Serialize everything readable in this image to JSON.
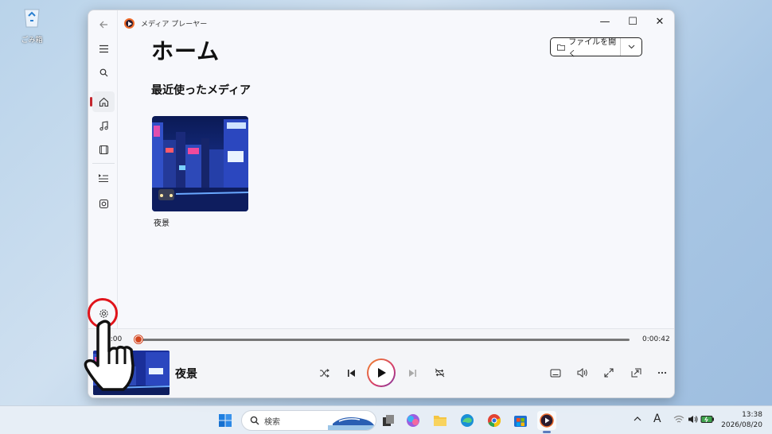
{
  "desktop": {
    "recycle_bin_label": "ごみ箱"
  },
  "window": {
    "app_title": "メディア プレーヤー",
    "controls": {
      "minimize": "—",
      "maximize": "☐",
      "close": "✕"
    }
  },
  "sidebar": {
    "items": [
      {
        "name": "back",
        "icon": "back-arrow-icon"
      },
      {
        "name": "menu",
        "icon": "hamburger-icon"
      },
      {
        "name": "search",
        "icon": "search-icon"
      },
      {
        "name": "home",
        "icon": "home-icon",
        "active": true
      },
      {
        "name": "music",
        "icon": "music-note-icon"
      },
      {
        "name": "video",
        "icon": "film-icon"
      },
      {
        "name": "play-queue",
        "icon": "queue-icon"
      },
      {
        "name": "playlists",
        "icon": "playlist-icon"
      },
      {
        "name": "settings",
        "icon": "gear-icon"
      }
    ]
  },
  "main": {
    "page_title": "ホーム",
    "open_file_label": "ファイルを開く",
    "section_title": "最近使ったメディア",
    "recent_media": [
      {
        "title": "夜景"
      }
    ]
  },
  "player": {
    "time_elapsed": "0:00",
    "time_total": "0:00:42",
    "progress_fraction": 0.0,
    "now_playing_title": "夜景"
  },
  "taskbar": {
    "search_placeholder": "検索",
    "ime_label": "A",
    "clock_time": "13:38",
    "clock_date": "2026/08/20"
  },
  "colors": {
    "accent_red": "#c4262e",
    "progress_knob": "#d2451e",
    "highlight_ring": "#e0141b"
  }
}
